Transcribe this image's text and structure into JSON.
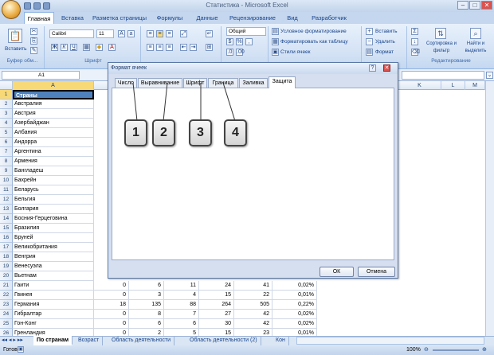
{
  "window": {
    "title": "Статистика - Microsoft Excel",
    "controls": [
      "–",
      "□",
      "✕"
    ]
  },
  "ribbon_tabs": [
    "Главная",
    "Вставка",
    "Разметка страницы",
    "Формулы",
    "Данные",
    "Рецензирование",
    "Вид",
    "Разработчик"
  ],
  "ribbon": {
    "paste_label": "Вставить",
    "clipboard_group": "Буфер обм...",
    "font_name": "Calibri",
    "font_size": "11",
    "font_group": "Шрифт",
    "number_format": "Общий",
    "styles": [
      "Условное форматирование",
      "Форматировать как таблицу",
      "Стили ячеек"
    ],
    "cells": [
      "Вставить",
      "Удалить",
      "Формат"
    ],
    "sort_label": "Сортировка и фильтр",
    "find_label": "Найти и выделить",
    "editing_group": "Редактирование"
  },
  "formula_bar": {
    "name_box": "A1"
  },
  "columns": [
    "A",
    "K",
    "L",
    "M"
  ],
  "rows": [
    {
      "n": "1",
      "c": "Страны"
    },
    {
      "n": "2",
      "c": "Австралия"
    },
    {
      "n": "3",
      "c": "Австрия"
    },
    {
      "n": "4",
      "c": "Азербайджан"
    },
    {
      "n": "5",
      "c": "Албания"
    },
    {
      "n": "6",
      "c": "Андорра"
    },
    {
      "n": "7",
      "c": "Аргентина"
    },
    {
      "n": "8",
      "c": "Армения"
    },
    {
      "n": "9",
      "c": "Бангладеш"
    },
    {
      "n": "10",
      "c": "Бахрейн"
    },
    {
      "n": "11",
      "c": "Беларусь"
    },
    {
      "n": "12",
      "c": "Бельгия"
    },
    {
      "n": "13",
      "c": "Болгария"
    },
    {
      "n": "14",
      "c": "Босния-Герцеговина"
    },
    {
      "n": "15",
      "c": "Бразилия"
    },
    {
      "n": "16",
      "c": "Бруней"
    },
    {
      "n": "17",
      "c": "Великобритания"
    },
    {
      "n": "18",
      "c": "Венгрия"
    },
    {
      "n": "19",
      "c": "Венесуэла"
    },
    {
      "n": "20",
      "c": "Вьетнам"
    },
    {
      "n": "21",
      "c": "Гаити",
      "v": [
        "0",
        "6",
        "11",
        "24",
        "41",
        "0,02%"
      ]
    },
    {
      "n": "22",
      "c": "Гвинея",
      "v": [
        "0",
        "3",
        "4",
        "15",
        "22",
        "0,01%"
      ]
    },
    {
      "n": "23",
      "c": "Германия",
      "v": [
        "18",
        "135",
        "88",
        "264",
        "505",
        "0,22%"
      ]
    },
    {
      "n": "24",
      "c": "Гибралтар",
      "v": [
        "0",
        "8",
        "7",
        "27",
        "42",
        "0,02%"
      ]
    },
    {
      "n": "25",
      "c": "Гон-Конг",
      "v": [
        "0",
        "6",
        "6",
        "30",
        "42",
        "0,02%"
      ]
    },
    {
      "n": "26",
      "c": "Гренландия",
      "v": [
        "0",
        "2",
        "5",
        "15",
        "23",
        "0,01%"
      ]
    }
  ],
  "sheet_tabs": [
    "По странам",
    "Возраст",
    "Область деятельности",
    "Область деятельности (2)",
    "Кон"
  ],
  "status": {
    "ready": "Готово",
    "zoom": "100%"
  },
  "dialog": {
    "title": "Формат ячеек",
    "tabs": [
      "Число",
      "Выравнивание",
      "Шрифт",
      "Граница",
      "Заливка",
      "Защита"
    ],
    "ok": "ОК",
    "cancel": "Отмена"
  },
  "callouts": [
    "1",
    "2",
    "3",
    "4"
  ]
}
